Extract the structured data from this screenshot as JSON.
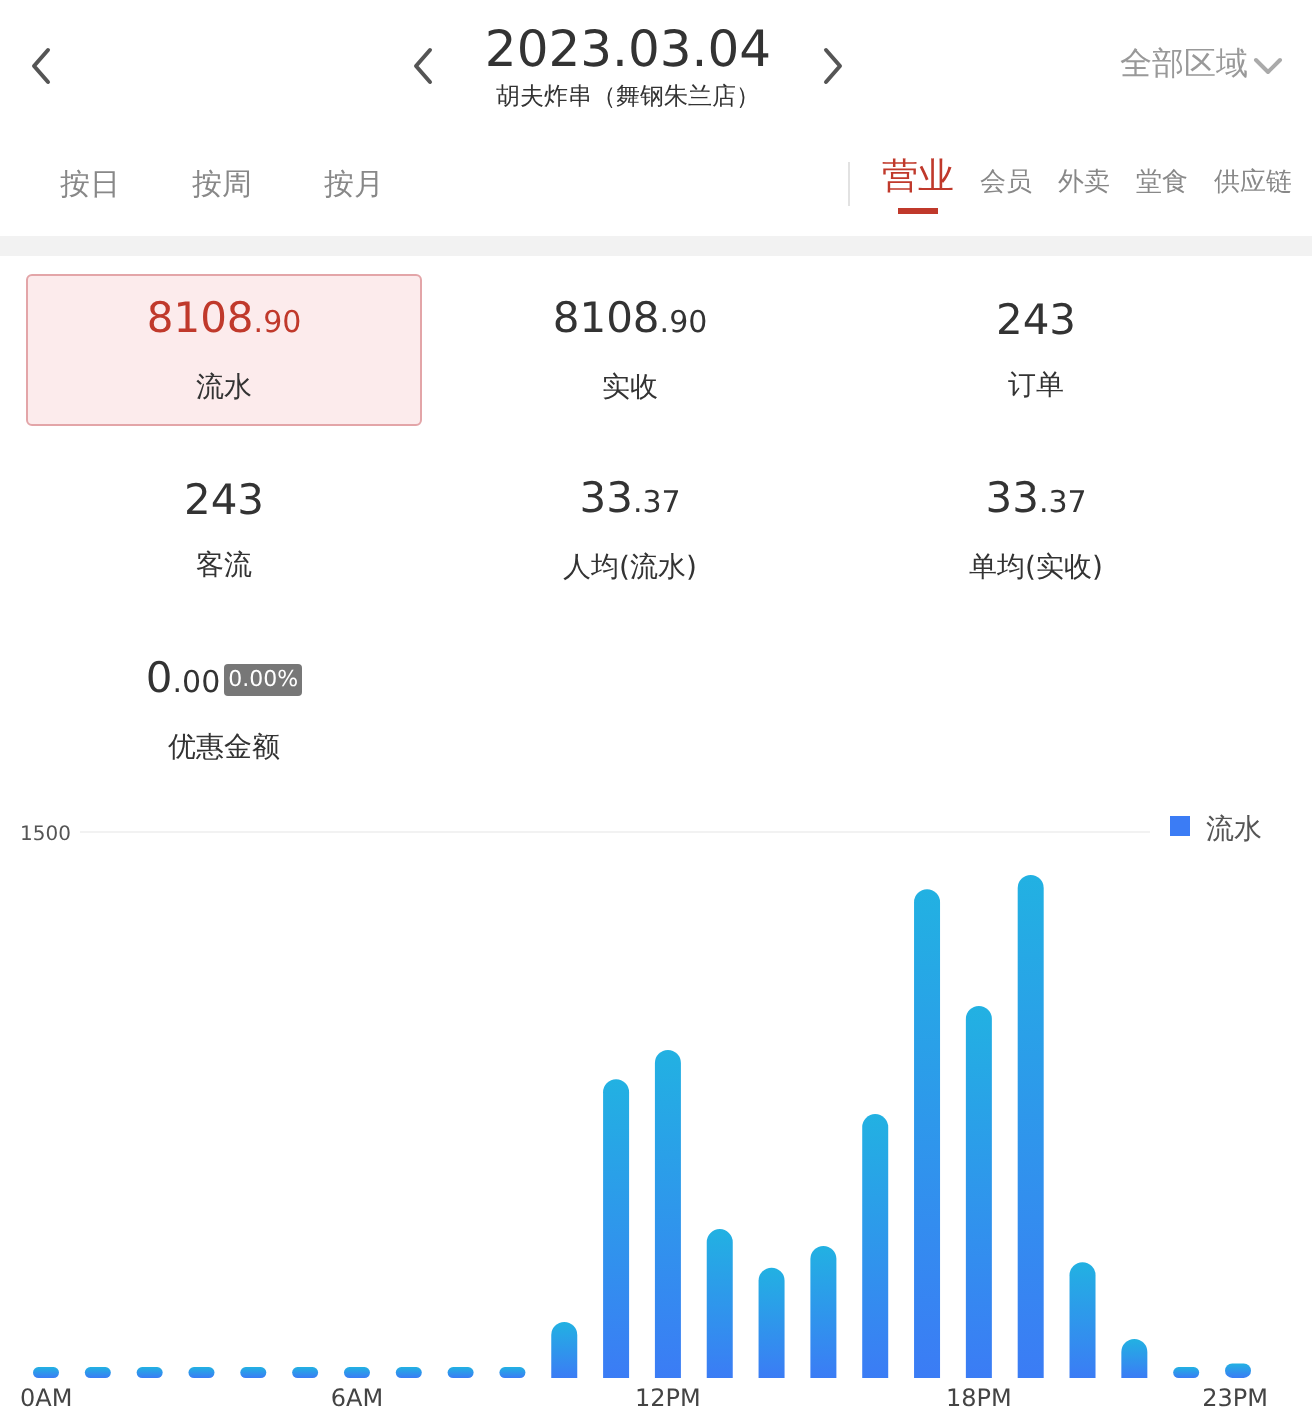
{
  "header": {
    "date": "2023.03.04",
    "store": "胡夫炸串（舞钢朱兰店）",
    "region": "全部区域"
  },
  "period_tabs": [
    {
      "label": "按日",
      "selected": false
    },
    {
      "label": "按周",
      "selected": false
    },
    {
      "label": "按月",
      "selected": false
    }
  ],
  "category_tabs": [
    {
      "label": "营业",
      "selected": true
    },
    {
      "label": "会员",
      "selected": false
    },
    {
      "label": "外卖",
      "selected": false
    },
    {
      "label": "堂食",
      "selected": false
    },
    {
      "label": "供应链",
      "selected": false
    }
  ],
  "metrics": [
    {
      "value": "8108.90",
      "label": "流水",
      "selected": true
    },
    {
      "value": "8108.90",
      "label": "实收",
      "selected": false
    },
    {
      "value": "243",
      "label": "订单",
      "selected": false
    },
    {
      "value": "243",
      "label": "客流",
      "selected": false
    },
    {
      "value": "33.37",
      "label": "人均(流水)",
      "selected": false
    },
    {
      "value": "33.37",
      "label": "单均(实收)",
      "selected": false
    },
    {
      "value": "0.00",
      "label": "优惠金额",
      "selected": false,
      "badge": "0.00%"
    }
  ],
  "chart": {
    "chart_data": {
      "type": "bar",
      "x": [
        0,
        1,
        2,
        3,
        4,
        5,
        6,
        7,
        8,
        9,
        10,
        11,
        12,
        13,
        14,
        15,
        16,
        17,
        18,
        19,
        20,
        21,
        22,
        23
      ],
      "xlim": [
        0,
        23
      ],
      "ylim": [
        0,
        1500
      ],
      "yticks": [
        1500
      ],
      "xticks": [
        {
          "value": 0,
          "label": "0AM"
        },
        {
          "value": 6,
          "label": "6AM"
        },
        {
          "value": 12,
          "label": "12PM"
        },
        {
          "value": 18,
          "label": "18PM"
        },
        {
          "value": 23,
          "label": "23PM"
        }
      ],
      "series": [
        {
          "name": "流水",
          "color": "#3b7cf5",
          "values": [
            30,
            30,
            30,
            30,
            30,
            30,
            30,
            30,
            30,
            30,
            154,
            821,
            901,
            409,
            303,
            363,
            725,
            1343,
            1022,
            1382,
            318,
            107,
            30,
            40
          ]
        }
      ]
    }
  }
}
